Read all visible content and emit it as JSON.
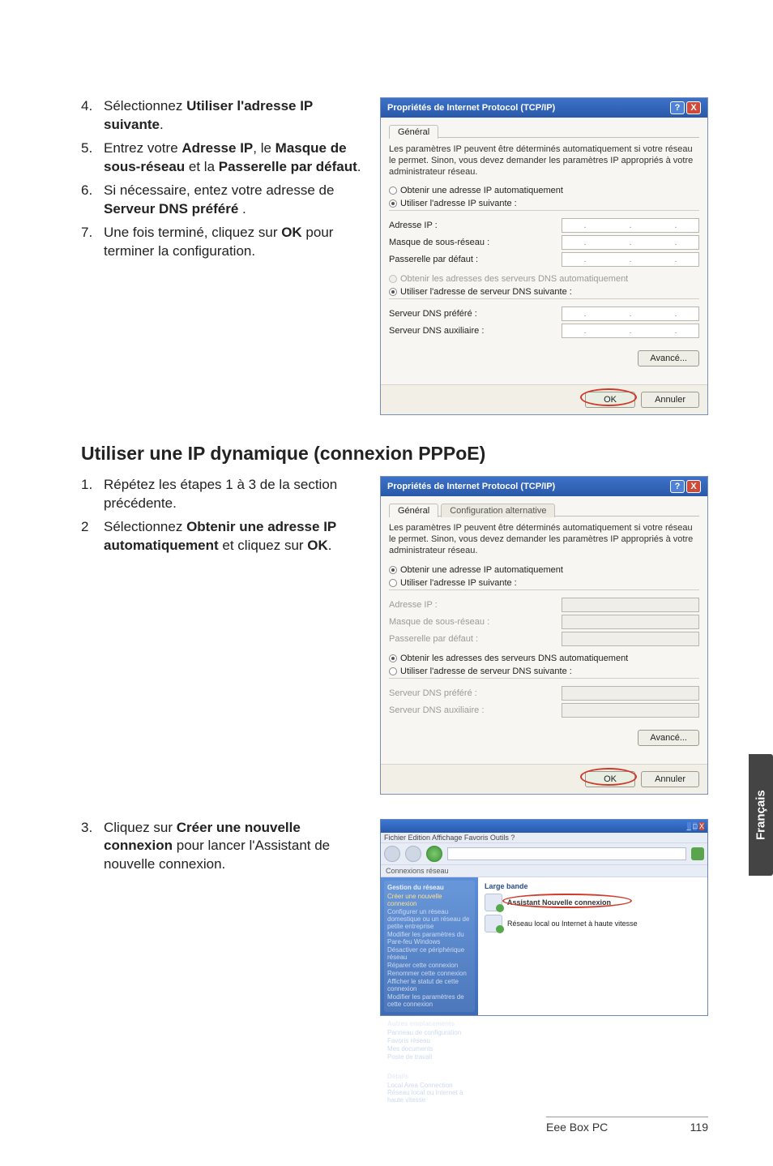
{
  "steps_a": [
    {
      "num": "4.",
      "html": "Sélectionnez <b>Utiliser l'adresse IP suivante</b>."
    },
    {
      "num": "5.",
      "html": "Entrez votre <b>Adresse IP</b>, le <b>Masque de sous-réseau</b> et la <b>Passerelle par défaut</b>."
    },
    {
      "num": "6.",
      "html": "Si nécessaire, entez votre adresse de <b>Serveur DNS préféré</b> ."
    },
    {
      "num": "7.",
      "html": "Une fois terminé, cliquez sur <b>OK</b> pour terminer la configuration."
    }
  ],
  "section_title": "Utiliser une IP dynamique (connexion PPPoE)",
  "steps_b": [
    {
      "num": "1.",
      "html": "Répétez les étapes 1 à 3 de la section précédente."
    },
    {
      "num": "2",
      "html": "Sélectionnez <b>Obtenir une adresse IP automatiquement</b> et cliquez sur <b>OK</b>."
    }
  ],
  "steps_c": [
    {
      "num": "3.",
      "html": "Cliquez sur <b>Créer une nouvelle connexion</b> pour lancer l'Assistant de nouvelle connexion."
    }
  ],
  "dlg": {
    "title": "Propriétés de Internet Protocol (TCP/IP)",
    "help": "?",
    "close": "X",
    "tab_general": "Général",
    "tab_alt": "Configuration alternative",
    "desc_static": "Les paramètres IP peuvent être déterminés automatiquement si votre réseau le permet. Sinon, vous devez demander les paramètres IP appropriés à votre administrateur réseau.",
    "desc_dyn": "Les paramètres IP peuvent être déterminés automatiquement si votre réseau le permet. Sinon, vous devez demander les paramètres IP appropriés à votre administrateur réseau.",
    "r_auto_ip": "Obtenir une adresse IP automatiquement",
    "r_use_ip": "Utiliser l'adresse IP suivante :",
    "f_ip": "Adresse IP :",
    "f_mask": "Masque de sous-réseau :",
    "f_gw": "Passerelle par défaut :",
    "r_auto_dns": "Obtenir les adresses des serveurs DNS automatiquement",
    "r_use_dns": "Utiliser l'adresse de serveur DNS suivante :",
    "f_dns1": "Serveur DNS préféré :",
    "f_dns2": "Serveur DNS auxiliaire :",
    "btn_adv": "Avancé...",
    "btn_ok": "OK",
    "btn_cancel": "Annuler"
  },
  "browser": {
    "menu": "Fichier   Edition   Affichage   Favoris   Outils   ?",
    "tabs": "Connexions réseau",
    "side": {
      "g1_hdr": "Gestion du réseau",
      "g1_items": [
        "Créer une nouvelle connexion",
        "Configurer un réseau domestique ou un réseau de petite entreprise",
        "Modifier les paramètres du Pare-feu Windows",
        "Désactiver ce périphérique réseau",
        "Réparer cette connexion",
        "Renommer cette connexion",
        "Afficher le statut de cette connexion",
        "Modifier les paramètres de cette connexion"
      ],
      "g2_hdr": "Autres emplacements",
      "g2_items": [
        "Panneau de configuration",
        "Favoris réseau",
        "Mes documents",
        "Poste de travail"
      ],
      "g3_hdr": "Détails",
      "g3_text": "Local Area Connection\nRéseau local ou Internet à haute vitesse"
    },
    "main": {
      "cat": "Large bande",
      "task1": "Assistant Nouvelle connexion",
      "task2_line1": "Réseau local ou Internet à haute vitesse",
      "task2_line2": ""
    }
  },
  "side_tab": "Français",
  "footer_model": "Eee Box PC",
  "footer_page": "119"
}
